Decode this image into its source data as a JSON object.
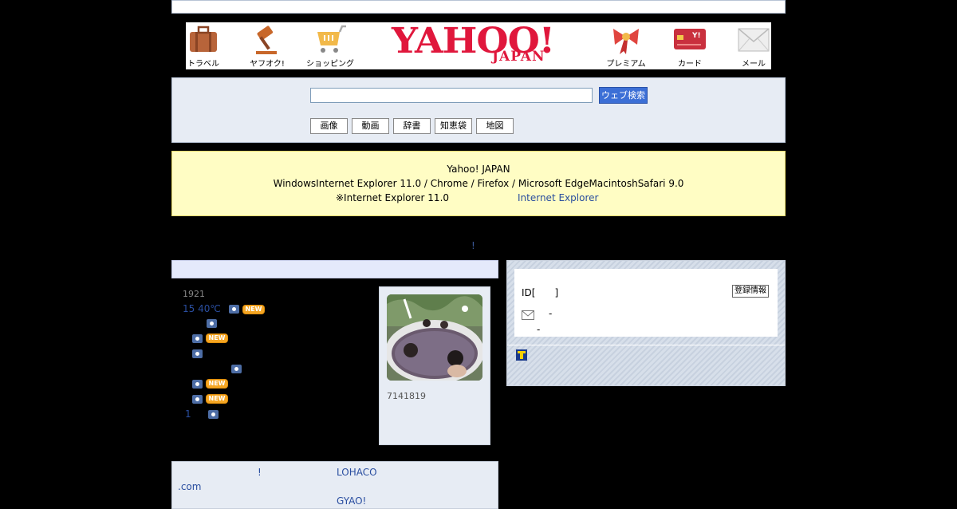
{
  "services": {
    "travel": "トラベル",
    "auction": "ヤフオク!",
    "shopping": "ショッピング",
    "premium": "プレミアム",
    "card": "カード",
    "mail": "メール"
  },
  "logo": {
    "main": "YAHOO!",
    "sub": "JAPAN"
  },
  "search": {
    "value": "",
    "button": "ウェブ検索",
    "tabs": [
      "画像",
      "動画",
      "辞書",
      "知恵袋",
      "地図"
    ]
  },
  "notice": {
    "line1": "Yahoo! JAPAN",
    "line2": "WindowsInternet Explorer 11.0 / Chrome  / Firefox  / Microsoft EdgeMacintoshSafari 9.0",
    "line3": "※Internet Explorer 11.0",
    "link": "Internet Explorer"
  },
  "headline_mark": "!",
  "news": {
    "time": "1921",
    "items": [
      "15 40℃",
      "",
      "",
      "",
      "",
      "",
      "",
      "1"
    ]
  },
  "photo": {
    "caption": "7141819"
  },
  "login": {
    "id_label": "ID[　　]",
    "register_button": "登録情報",
    "mail_dash": "-",
    "second_dash": "-"
  },
  "bottom": {
    "item1": "!",
    "item2": "LOHACO",
    "item3": ".com",
    "item4": "GYAO!"
  },
  "colors": {
    "logo_red": "#e0173c",
    "search_button": "#3c6fd6",
    "notice_bg": "#fffdc4",
    "link": "#2a4e9e"
  }
}
